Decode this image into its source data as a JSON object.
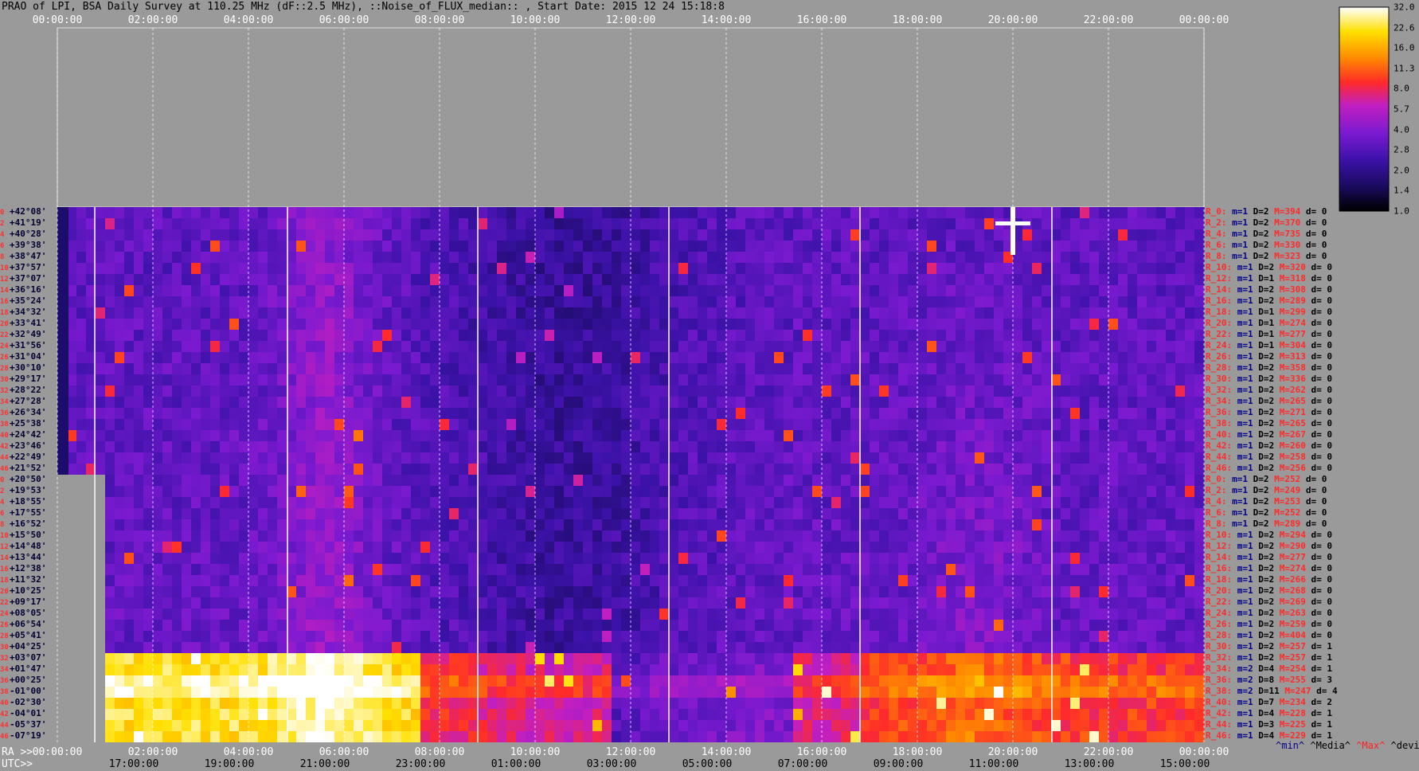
{
  "title": "PRAO of LPI, BSA Daily Survey at 110.25 MHz (dF::2.5 MHz), ::Noise_of_FLUX_median:: , Start Date: 2015 12 24 15:18:8",
  "top_ticks": [
    "00:00:00",
    "02:00:00",
    "04:00:00",
    "06:00:00",
    "08:00:00",
    "10:00:00",
    "12:00:00",
    "14:00:00",
    "16:00:00",
    "18:00:00",
    "20:00:00",
    "22:00:00",
    "00:00:00"
  ],
  "ra_label": "RA >>",
  "ra_ticks": [
    "00:00:00",
    "02:00:00",
    "04:00:00",
    "06:00:00",
    "08:00:00",
    "10:00:00",
    "12:00:00",
    "14:00:00",
    "16:00:00",
    "18:00:00",
    "20:00:00",
    "22:00:00",
    "00:00:00"
  ],
  "utc_label": "UTC>>",
  "utc_ticks": [
    "17:00:00",
    "19:00:00",
    "21:00:00",
    "23:00:00",
    "01:00:00",
    "03:00:00",
    "05:00:00",
    "07:00:00",
    "09:00:00",
    "11:00:00",
    "13:00:00",
    "15:00:00"
  ],
  "declinations": [
    "+42°08'",
    "+41°19'",
    "+40°28'",
    "+39°38'",
    "+38°47'",
    "+37°57'",
    "+37°07'",
    "+36°16'",
    "+35°24'",
    "+34°32'",
    "+33°41'",
    "+32°49'",
    "+31°56'",
    "+31°04'",
    "+30°10'",
    "+29°17'",
    "+28°22'",
    "+27°28'",
    "+26°34'",
    "+25°38'",
    "+24°42'",
    "+23°46'",
    "+22°49'",
    "+21°52'",
    "+20°50'",
    "+19°53'",
    "+18°55'",
    "+17°55'",
    "+16°52'",
    "+15°50'",
    "+14°48'",
    "+13°44'",
    "+12°38'",
    "+11°32'",
    "+10°25'",
    "+09°17'",
    "+08°05'",
    "+06°54'",
    "+05°41'",
    "+04°25'",
    "+03°07'",
    "+01°47'",
    "+00°25'",
    "-01°00'",
    "-02°30'",
    "-04°01'",
    "-05°37'",
    "-07°19'"
  ],
  "row_numbers": [
    "0",
    "2",
    "4",
    "6",
    "8",
    "10",
    "12",
    "14",
    "16",
    "18",
    "20",
    "22",
    "24",
    "26",
    "28",
    "30",
    "32",
    "34",
    "36",
    "38",
    "40",
    "42",
    "44",
    "46",
    "0",
    "2",
    "4",
    "6",
    "8",
    "10",
    "12",
    "14",
    "16",
    "18",
    "20",
    "22",
    "24",
    "26",
    "28",
    "30",
    "32",
    "34",
    "36",
    "38",
    "40",
    "42",
    "44",
    "46"
  ],
  "stats": [
    {
      "r": "R_0:",
      "m": "m=1",
      "d": "D=2",
      "mx": "M=394",
      "dv": "d= 0"
    },
    {
      "r": "R_2:",
      "m": "m=1",
      "d": "D=2",
      "mx": "M=370",
      "dv": "d= 0"
    },
    {
      "r": "R_4:",
      "m": "m=1",
      "d": "D=2",
      "mx": "M=735",
      "dv": "d= 0"
    },
    {
      "r": "R_6:",
      "m": "m=1",
      "d": "D=2",
      "mx": "M=330",
      "dv": "d= 0"
    },
    {
      "r": "R_8:",
      "m": "m=1",
      "d": "D=2",
      "mx": "M=323",
      "dv": "d= 0"
    },
    {
      "r": "R_10:",
      "m": "m=1",
      "d": "D=2",
      "mx": "M=320",
      "dv": "d= 0"
    },
    {
      "r": "R_12:",
      "m": "m=1",
      "d": "D=1",
      "mx": "M=318",
      "dv": "d= 0"
    },
    {
      "r": "R_14:",
      "m": "m=1",
      "d": "D=2",
      "mx": "M=308",
      "dv": "d= 0"
    },
    {
      "r": "R_16:",
      "m": "m=1",
      "d": "D=2",
      "mx": "M=289",
      "dv": "d= 0"
    },
    {
      "r": "R_18:",
      "m": "m=1",
      "d": "D=1",
      "mx": "M=299",
      "dv": "d= 0"
    },
    {
      "r": "R_20:",
      "m": "m=1",
      "d": "D=1",
      "mx": "M=274",
      "dv": "d= 0"
    },
    {
      "r": "R_22:",
      "m": "m=1",
      "d": "D=1",
      "mx": "M=277",
      "dv": "d= 0"
    },
    {
      "r": "R_24:",
      "m": "m=1",
      "d": "D=1",
      "mx": "M=304",
      "dv": "d= 0"
    },
    {
      "r": "R_26:",
      "m": "m=1",
      "d": "D=2",
      "mx": "M=313",
      "dv": "d= 0"
    },
    {
      "r": "R_28:",
      "m": "m=1",
      "d": "D=2",
      "mx": "M=358",
      "dv": "d= 0"
    },
    {
      "r": "R_30:",
      "m": "m=1",
      "d": "D=2",
      "mx": "M=336",
      "dv": "d= 0"
    },
    {
      "r": "R_32:",
      "m": "m=1",
      "d": "D=2",
      "mx": "M=262",
      "dv": "d= 0"
    },
    {
      "r": "R_34:",
      "m": "m=1",
      "d": "D=2",
      "mx": "M=265",
      "dv": "d= 0"
    },
    {
      "r": "R_36:",
      "m": "m=1",
      "d": "D=2",
      "mx": "M=271",
      "dv": "d= 0"
    },
    {
      "r": "R_38:",
      "m": "m=1",
      "d": "D=2",
      "mx": "M=265",
      "dv": "d= 0"
    },
    {
      "r": "R_40:",
      "m": "m=1",
      "d": "D=2",
      "mx": "M=267",
      "dv": "d= 0"
    },
    {
      "r": "R_42:",
      "m": "m=1",
      "d": "D=2",
      "mx": "M=260",
      "dv": "d= 0"
    },
    {
      "r": "R_44:",
      "m": "m=1",
      "d": "D=2",
      "mx": "M=258",
      "dv": "d= 0"
    },
    {
      "r": "R_46:",
      "m": "m=1",
      "d": "D=2",
      "mx": "M=256",
      "dv": "d= 0"
    },
    {
      "r": "R_0:",
      "m": "m=1",
      "d": "D=2",
      "mx": "M=252",
      "dv": "d= 0"
    },
    {
      "r": "R_2:",
      "m": "m=1",
      "d": "D=2",
      "mx": "M=249",
      "dv": "d= 0"
    },
    {
      "r": "R_4:",
      "m": "m=1",
      "d": "D=2",
      "mx": "M=253",
      "dv": "d= 0"
    },
    {
      "r": "R_6:",
      "m": "m=1",
      "d": "D=2",
      "mx": "M=252",
      "dv": "d= 0"
    },
    {
      "r": "R_8:",
      "m": "m=1",
      "d": "D=2",
      "mx": "M=289",
      "dv": "d= 0"
    },
    {
      "r": "R_10:",
      "m": "m=1",
      "d": "D=2",
      "mx": "M=294",
      "dv": "d= 0"
    },
    {
      "r": "R_12:",
      "m": "m=1",
      "d": "D=2",
      "mx": "M=290",
      "dv": "d= 0"
    },
    {
      "r": "R_14:",
      "m": "m=1",
      "d": "D=2",
      "mx": "M=277",
      "dv": "d= 0"
    },
    {
      "r": "R_16:",
      "m": "m=1",
      "d": "D=2",
      "mx": "M=274",
      "dv": "d= 0"
    },
    {
      "r": "R_18:",
      "m": "m=1",
      "d": "D=2",
      "mx": "M=266",
      "dv": "d= 0"
    },
    {
      "r": "R_20:",
      "m": "m=1",
      "d": "D=2",
      "mx": "M=268",
      "dv": "d= 0"
    },
    {
      "r": "R_22:",
      "m": "m=1",
      "d": "D=2",
      "mx": "M=269",
      "dv": "d= 0"
    },
    {
      "r": "R_24:",
      "m": "m=1",
      "d": "D=2",
      "mx": "M=263",
      "dv": "d= 0"
    },
    {
      "r": "R_26:",
      "m": "m=1",
      "d": "D=2",
      "mx": "M=259",
      "dv": "d= 0"
    },
    {
      "r": "R_28:",
      "m": "m=1",
      "d": "D=2",
      "mx": "M=404",
      "dv": "d= 0"
    },
    {
      "r": "R_30:",
      "m": "m=1",
      "d": "D=2",
      "mx": "M=257",
      "dv": "d= 1"
    },
    {
      "r": "R_32:",
      "m": "m=1",
      "d": "D=2",
      "mx": "M=257",
      "dv": "d= 1"
    },
    {
      "r": "R_34:",
      "m": "m=2",
      "d": "D=4",
      "mx": "M=254",
      "dv": "d= 1"
    },
    {
      "r": "R_36:",
      "m": "m=2",
      "d": "D=8",
      "mx": "M=255",
      "dv": "d= 3"
    },
    {
      "r": "R_38:",
      "m": "m=2",
      "d": "D=11",
      "mx": "M=247",
      "dv": "d= 4"
    },
    {
      "r": "R_40:",
      "m": "m=1",
      "d": "D=7",
      "mx": "M=234",
      "dv": "d= 2"
    },
    {
      "r": "R_42:",
      "m": "m=1",
      "d": "D=4",
      "mx": "M=228",
      "dv": "d= 1"
    },
    {
      "r": "R_44:",
      "m": "m=1",
      "d": "D=3",
      "mx": "M=225",
      "dv": "d= 1"
    },
    {
      "r": "R_46:",
      "m": "m=1",
      "d": "D=4",
      "mx": "M=229",
      "dv": "d= 1"
    }
  ],
  "colorbar_ticks": [
    "32.0",
    "22.6",
    "16.0",
    "11.3",
    "8.0",
    "5.7",
    "4.0",
    "2.8",
    "2.0",
    "1.4",
    "1.0"
  ],
  "legend": {
    "min": "^min^",
    "median": "^Media^",
    "max": "^Max^",
    "dev": "^devia^"
  },
  "chart_data": {
    "type": "heatmap",
    "title": "PRAO of LPI, BSA Daily Survey at 110.25 MHz (dF::2.5 MHz), ::Noise_of_FLUX_median:: , Start Date: 2015 12 24 15:18:8",
    "xlabel": "RA / UTC",
    "ylabel": "",
    "x_range": [
      "00:00:00",
      "00:00:00"
    ],
    "color_scale": "log",
    "z_range": [
      1.0,
      32.0
    ],
    "colormap": [
      "#000000",
      "#1a0a5e",
      "#3b12a8",
      "#7a1ad0",
      "#c21fc0",
      "#ff2a2a",
      "#ff8a00",
      "#ffe000",
      "#ffffff"
    ],
    "notes_visible": "ra labels top and bottom; utc labels bottom"
  }
}
